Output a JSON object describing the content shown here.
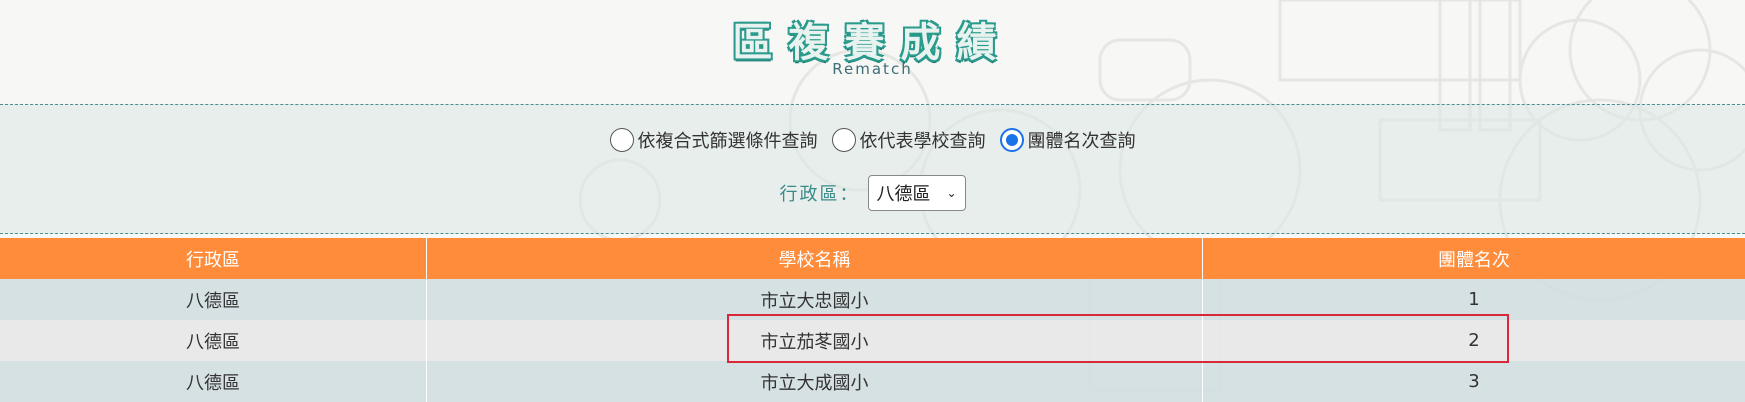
{
  "header": {
    "title": "區複賽成績",
    "subtitle": "Rematch"
  },
  "filters": {
    "radios": [
      {
        "label": "依複合式篩選條件查詢",
        "checked": false
      },
      {
        "label": "依代表學校查詢",
        "checked": false
      },
      {
        "label": "團體名次查詢",
        "checked": true
      }
    ],
    "district_label": "行政區：",
    "district_selected": "八德區"
  },
  "table": {
    "columns": [
      "行政區",
      "學校名稱",
      "團體名次"
    ],
    "rows": [
      {
        "district": "八德區",
        "school": "市立大忠國小",
        "rank": "1"
      },
      {
        "district": "八德區",
        "school": "市立茄苳國小",
        "rank": "2"
      },
      {
        "district": "八德區",
        "school": "市立大成國小",
        "rank": "3"
      }
    ]
  },
  "colors": {
    "accent": "#ff8c3a",
    "title_teal": "#2a9a8c",
    "radio_selected": "#1a73e8",
    "highlight": "#d8283a"
  }
}
